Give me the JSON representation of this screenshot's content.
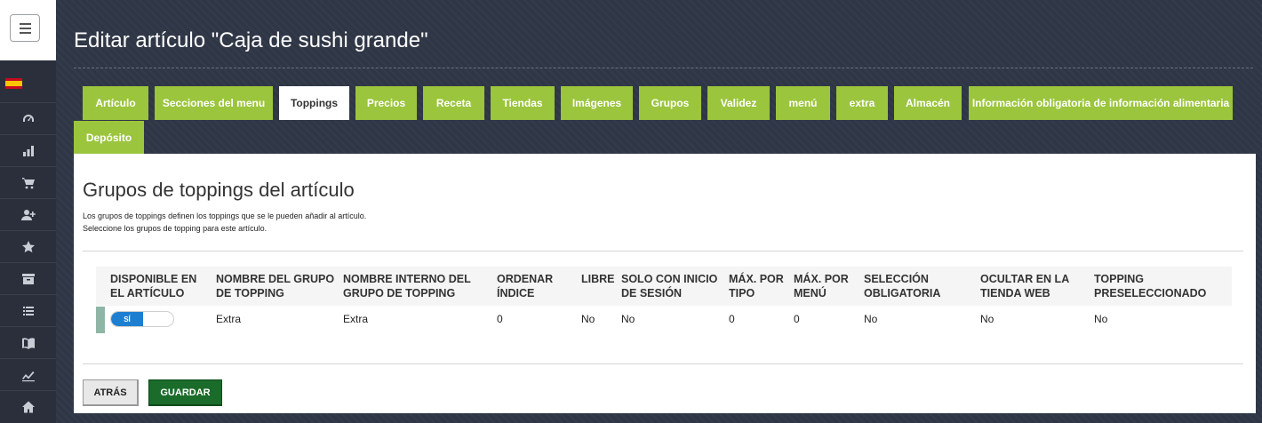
{
  "page": {
    "title": "Editar artículo \"Caja de sushi grande\""
  },
  "sidebar": {
    "language_flag": "es",
    "items": [
      {
        "icon": "dashboard-gauge-icon"
      },
      {
        "icon": "bar-chart-icon"
      },
      {
        "icon": "shopping-cart-icon"
      },
      {
        "icon": "add-user-icon"
      },
      {
        "icon": "star-icon"
      },
      {
        "icon": "archive-box-icon"
      },
      {
        "icon": "list-icon"
      },
      {
        "icon": "book-icon"
      },
      {
        "icon": "trend-line-icon"
      },
      {
        "icon": "home-icon"
      }
    ]
  },
  "tabs": [
    {
      "label": "Artículo"
    },
    {
      "label": "Secciones del menu"
    },
    {
      "label": "Toppings",
      "active": true
    },
    {
      "label": "Precios"
    },
    {
      "label": "Receta"
    },
    {
      "label": "Tiendas"
    },
    {
      "label": "Imágenes"
    },
    {
      "label": "Grupos"
    },
    {
      "label": "Validez"
    },
    {
      "label": "menú"
    },
    {
      "label": "extra"
    },
    {
      "label": "Almacén"
    },
    {
      "label": "Información obligatoria de información alimentaria"
    },
    {
      "label": "Depósito"
    }
  ],
  "section": {
    "title": "Grupos de toppings del artículo",
    "description_line1": "Los grupos de toppings definen los toppings que se le pueden añadir al artículo.",
    "description_line2": "Seleccione los grupos de topping para este artículo."
  },
  "table": {
    "columns": [
      {
        "l1": "DISPONIBLE EN",
        "l2": "EL ARTÍCULO"
      },
      {
        "l1": "NOMBRE DEL GRUPO",
        "l2": "DE TOPPING"
      },
      {
        "l1": "NOMBRE INTERNO DEL",
        "l2": "GRUPO DE TOPPING"
      },
      {
        "l1": "ORDENAR",
        "l2": "ÍNDICE"
      },
      {
        "l1": "LIBRE",
        "l2": ""
      },
      {
        "l1": "SOLO CON INICIO",
        "l2": "DE SESIÓN"
      },
      {
        "l1": "MÁX. POR",
        "l2": "TIPO"
      },
      {
        "l1": "MÁX. POR",
        "l2": "MENÚ"
      },
      {
        "l1": "SELECCIÓN",
        "l2": "OBLIGATORIA"
      },
      {
        "l1": "OCULTAR EN LA",
        "l2": "TIENDA WEB"
      },
      {
        "l1": "TOPPING",
        "l2": "PRESELECCIONADO"
      }
    ],
    "rows": [
      {
        "available_toggle": "SÍ",
        "group_name": "Extra",
        "internal_name": "Extra",
        "sort_index": "0",
        "free": "No",
        "login_only": "No",
        "max_per_type": "0",
        "max_per_menu": "0",
        "mandatory": "No",
        "hide_webshop": "No",
        "preselected": "No"
      }
    ]
  },
  "buttons": {
    "back": "ATRÁS",
    "save": "GUARDAR"
  },
  "colors": {
    "tab_green": "#9bc53d",
    "save_green": "#1b6b2a",
    "toggle_blue": "#1e7fd0"
  }
}
